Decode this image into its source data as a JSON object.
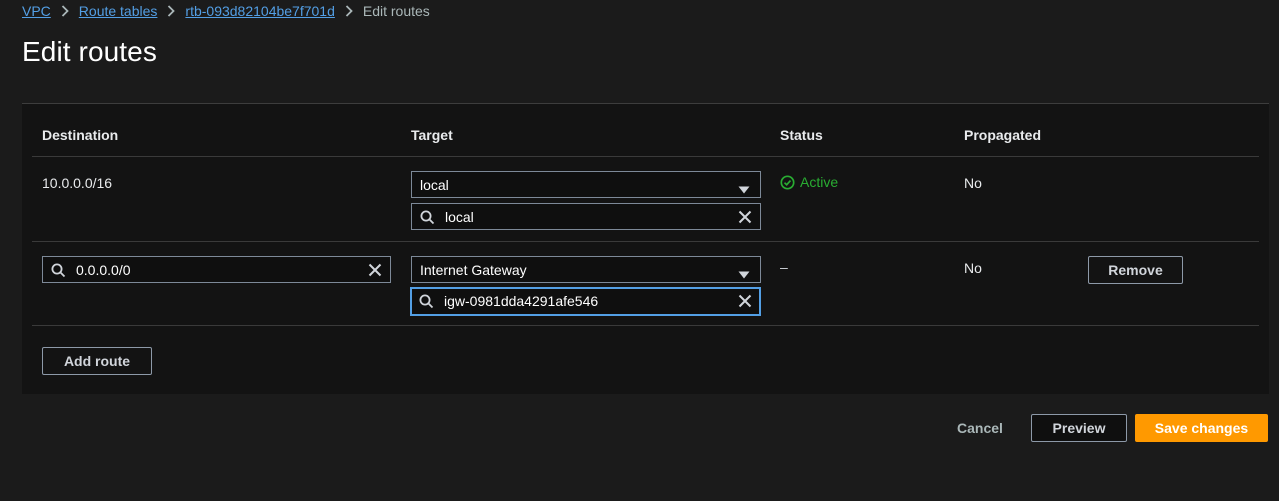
{
  "breadcrumb": {
    "items": [
      {
        "label": "VPC"
      },
      {
        "label": "Route tables"
      },
      {
        "label": "rtb-093d82104be7f701d"
      }
    ],
    "current": "Edit routes"
  },
  "page": {
    "title": "Edit routes"
  },
  "table": {
    "columns": [
      "Destination",
      "Target",
      "Status",
      "Propagated"
    ],
    "rows": [
      {
        "destination": "10.0.0.0/16",
        "target_type": "local",
        "target_search": "local",
        "status": "Active",
        "propagated": "No"
      },
      {
        "destination": "0.0.0.0/0",
        "target_type": "Internet Gateway",
        "target_search": "igw-0981dda4291afe546",
        "status": "–",
        "propagated": "No",
        "remove_label": "Remove"
      }
    ],
    "add_route_label": "Add route"
  },
  "footer": {
    "cancel_label": "Cancel",
    "preview_label": "Preview",
    "save_label": "Save changes"
  },
  "colors": {
    "background": "#1b1b1b",
    "panel": "#131313",
    "link": "#539fe5",
    "status_active": "#29ad32",
    "primary": "#ff9900",
    "focus": "#539fe5"
  },
  "icons": [
    "chevron-right-icon",
    "caret-down-icon",
    "search-icon",
    "clear-icon",
    "check-circle-icon"
  ]
}
